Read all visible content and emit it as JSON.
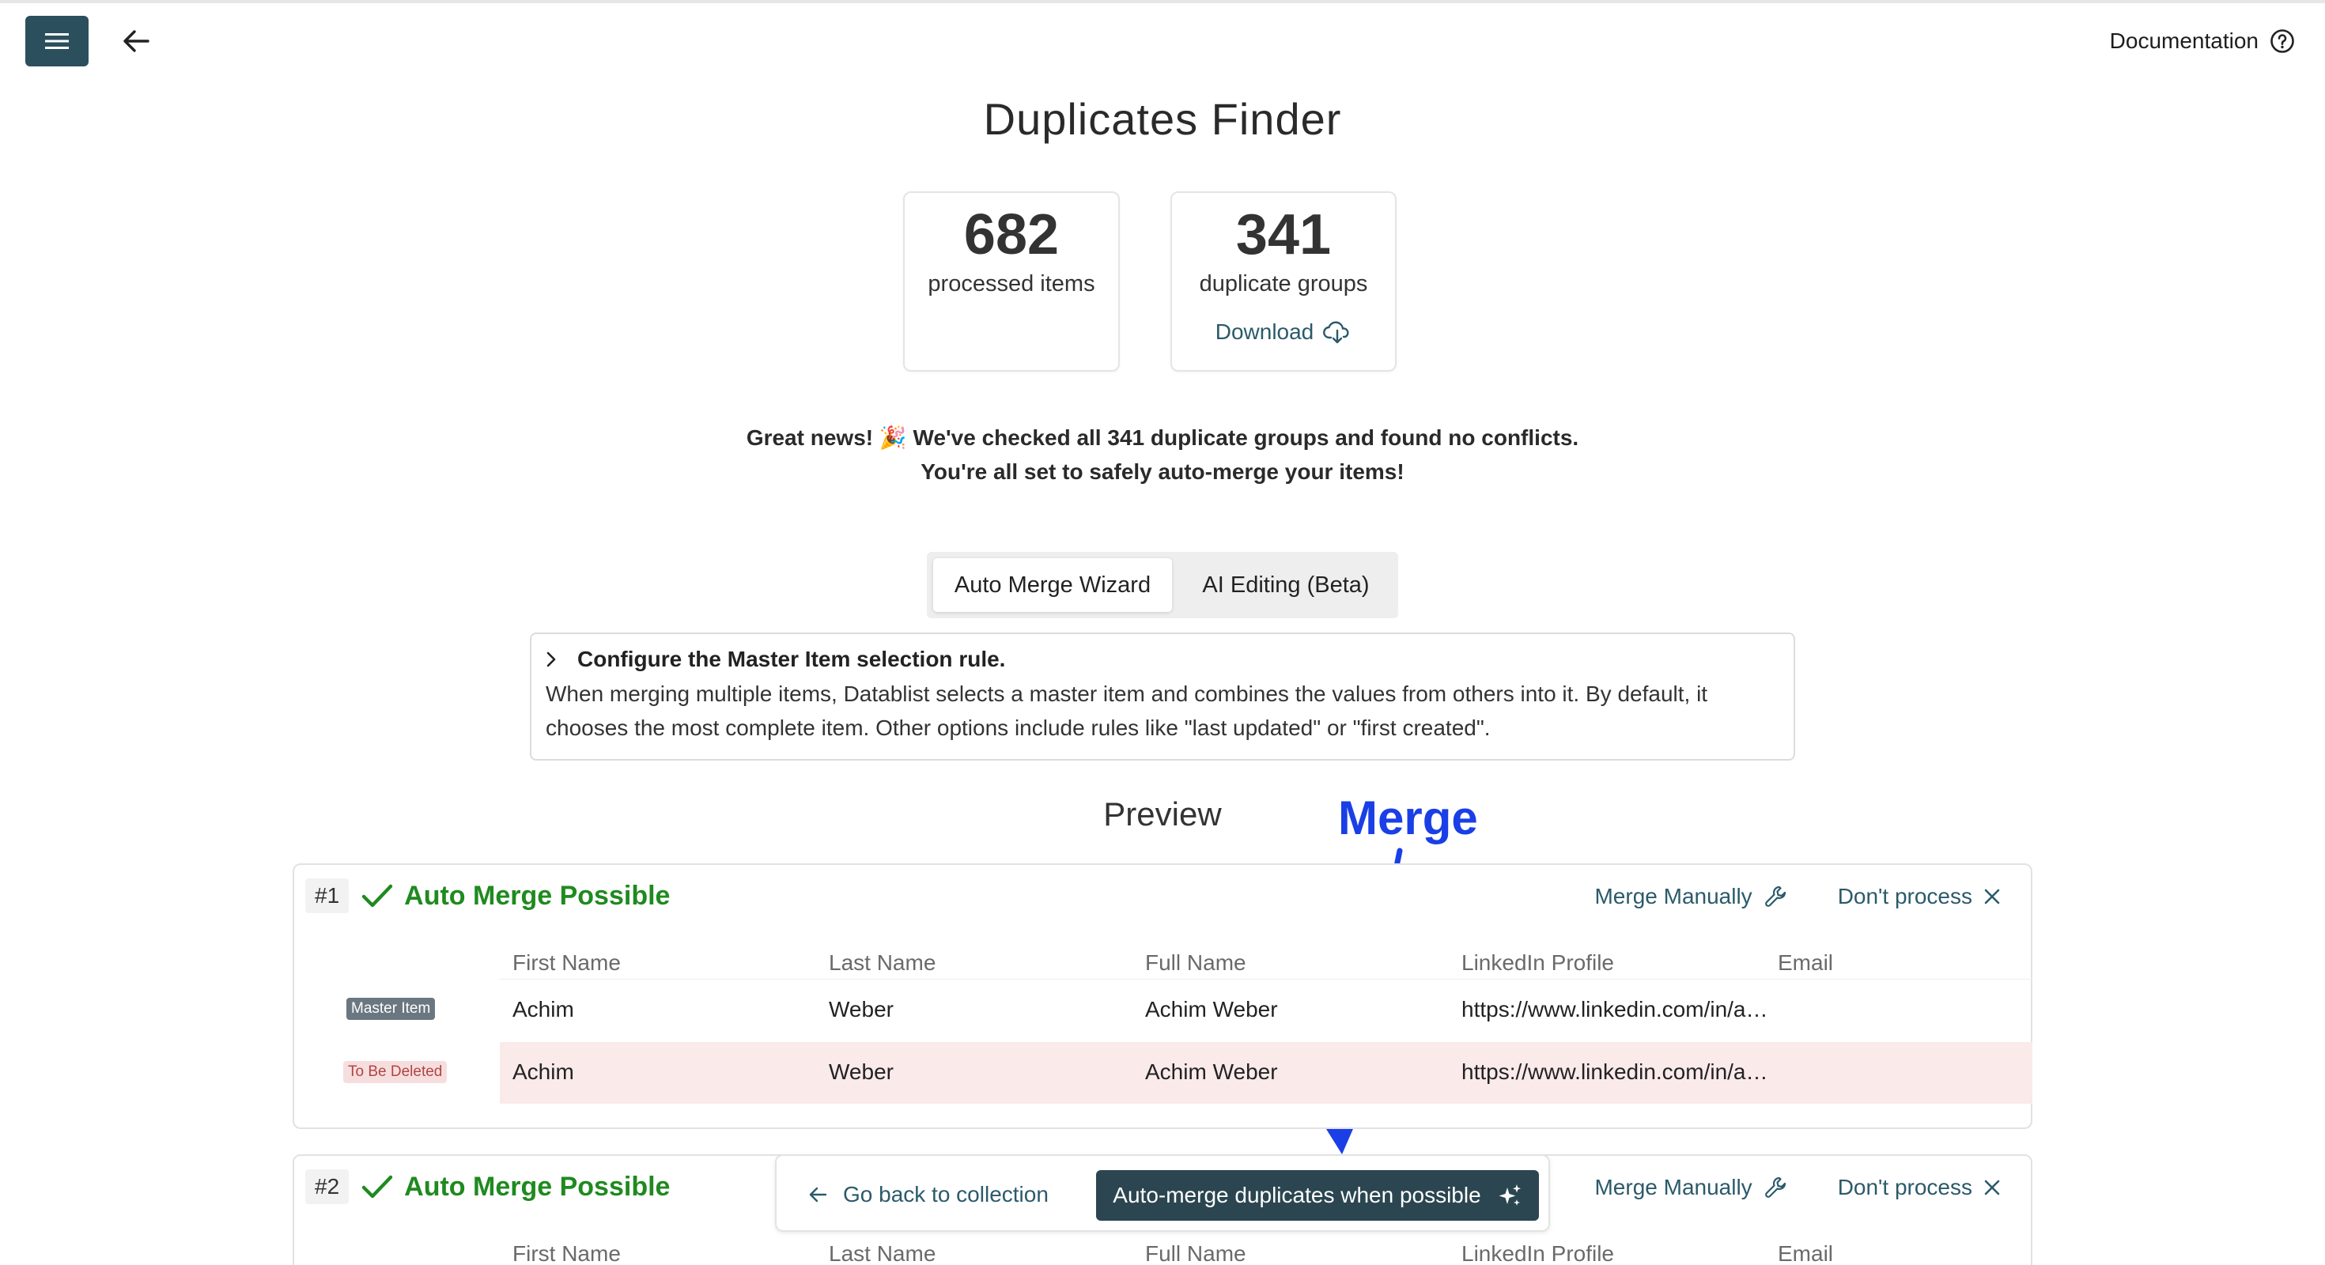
{
  "header": {
    "documentation_label": "Documentation"
  },
  "page": {
    "title": "Duplicates Finder"
  },
  "stats": {
    "processed": {
      "value": "682",
      "label": "processed items"
    },
    "groups": {
      "value": "341",
      "label": "duplicate groups",
      "download_label": "Download"
    }
  },
  "message": {
    "line1_a": "Great news!",
    "line1_emoji": "🎉",
    "line1_b": "We've checked all 341 duplicate groups and found no conflicts.",
    "line2": "You're all set to safely auto-merge your items!"
  },
  "tabs": [
    {
      "label": "Auto Merge Wizard",
      "active": true
    },
    {
      "label": "AI Editing (Beta)",
      "active": false
    }
  ],
  "config": {
    "title": "Configure the Master Item selection rule.",
    "description": "When merging multiple items, Datablist selects a master item and combines the values from others into it. By default, it chooses the most complete item. Other options include rules like \"last updated\" or \"first created\"."
  },
  "preview": {
    "title": "Preview",
    "annotation": "Merge"
  },
  "columns": [
    "First Name",
    "Last Name",
    "Full Name",
    "LinkedIn Profile",
    "Email"
  ],
  "groups": [
    {
      "number": "#1",
      "status": "Auto Merge Possible",
      "merge_manually": "Merge Manually",
      "dont_process": "Don't process",
      "rows": [
        {
          "badge": "Master Item",
          "first": "Achim",
          "last": "Weber",
          "full": "Achim Weber",
          "linkedin": "https://www.linkedin.com/in/achim-weber",
          "email": ""
        },
        {
          "badge": "To Be Deleted",
          "first": "Achim",
          "last": "Weber",
          "full": "Achim Weber",
          "linkedin": "https://www.linkedin.com/in/achim-weber",
          "email": ""
        }
      ]
    },
    {
      "number": "#2",
      "status": "Auto Merge Possible",
      "merge_manually": "Merge Manually",
      "dont_process": "Don't process"
    }
  ],
  "bottom_bar": {
    "go_back": "Go back to collection",
    "auto_merge": "Auto-merge duplicates when possible"
  },
  "colors": {
    "primary_dark": "#2b4f5c",
    "link": "#2b5a6a",
    "success": "#1f8a1f",
    "annotation": "#1a3fe6",
    "delete_row": "#fbeaea"
  },
  "icons": [
    "menu-icon",
    "arrow-left-icon",
    "help-circle-icon",
    "cloud-download-icon",
    "chevron-right-icon",
    "check-icon",
    "wrench-icon",
    "close-icon",
    "sparkles-icon"
  ]
}
